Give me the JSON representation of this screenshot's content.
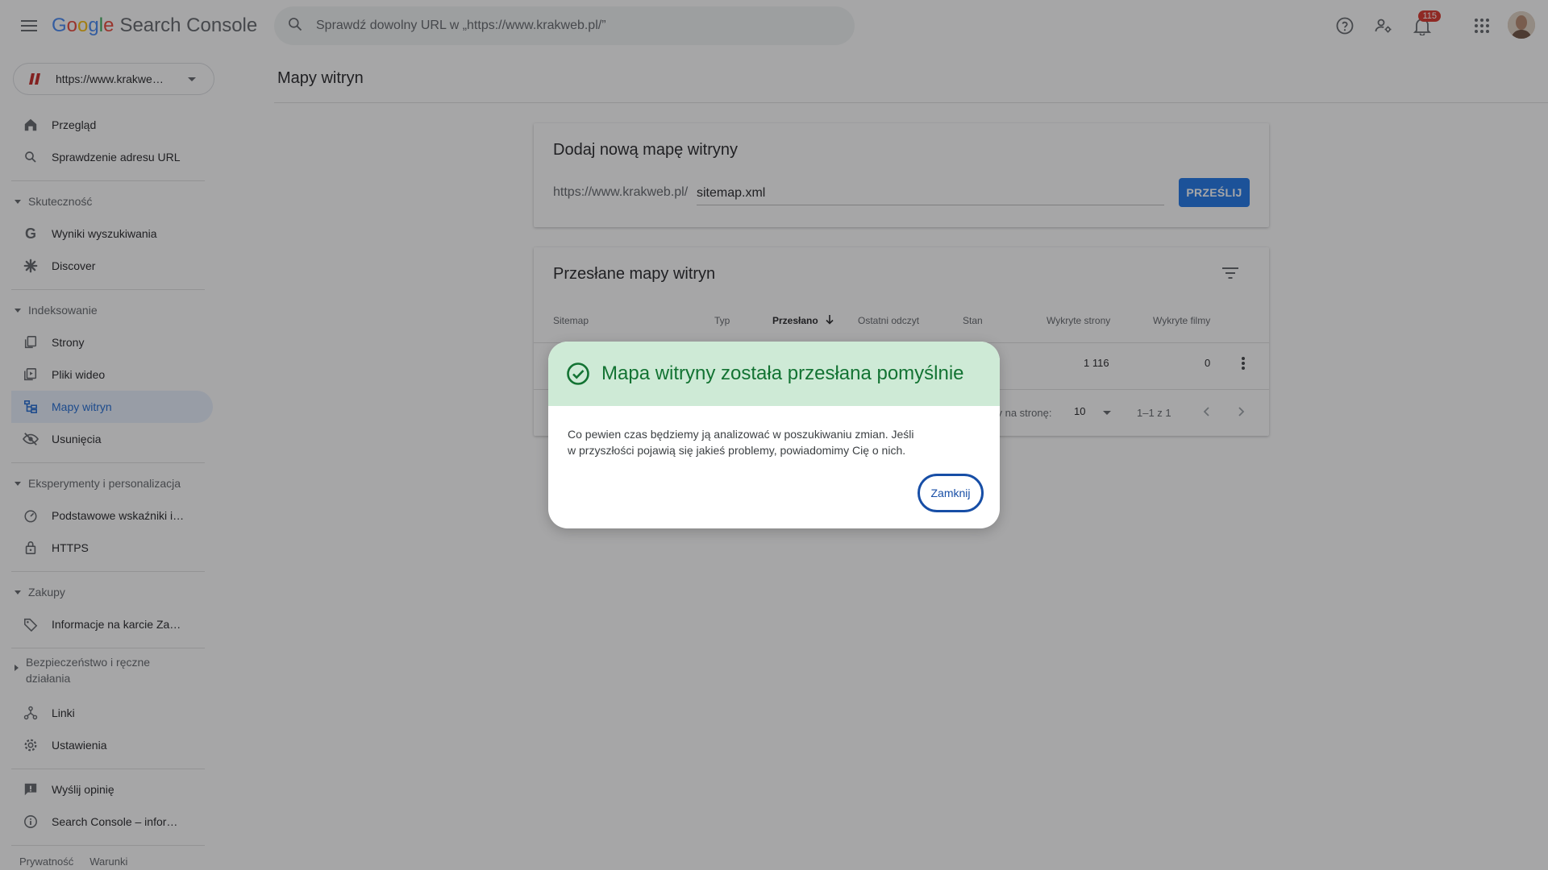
{
  "app": {
    "logo_letters": [
      "G",
      "o",
      "o",
      "g",
      "l",
      "e"
    ],
    "product_name": "Search Console"
  },
  "search": {
    "placeholder": "Sprawdź dowolny URL w „https://www.krakweb.pl/”"
  },
  "topbar": {
    "notifications_count": "115"
  },
  "property": {
    "label": "https://www.krakwe…"
  },
  "sidebar": {
    "items": [
      {
        "label": "Przegląd",
        "icon": "home-icon"
      },
      {
        "label": "Sprawdzenie adresu URL",
        "icon": "search-icon"
      }
    ],
    "sections": [
      {
        "label": "Skuteczność",
        "items": [
          {
            "label": "Wyniki wyszukiwania",
            "icon": "google-g-icon"
          },
          {
            "label": "Discover",
            "icon": "asterisk-icon"
          }
        ]
      },
      {
        "label": "Indeksowanie",
        "items": [
          {
            "label": "Strony",
            "icon": "pages-icon"
          },
          {
            "label": "Pliki wideo",
            "icon": "video-pages-icon"
          },
          {
            "label": "Mapy witryn",
            "icon": "sitemap-icon"
          },
          {
            "label": "Usunięcia",
            "icon": "eye-off-icon"
          }
        ]
      },
      {
        "label": "Eksperymenty i personalizacja",
        "items": [
          {
            "label": "Podstawowe wskaźniki i…",
            "icon": "speed-icon"
          },
          {
            "label": "HTTPS",
            "icon": "lock-icon"
          }
        ]
      },
      {
        "label": "Zakupy",
        "items": [
          {
            "label": "Informacje na karcie Za…",
            "icon": "tag-icon"
          }
        ]
      },
      {
        "label": "Bezpieczeństwo i ręczne działania",
        "items": []
      }
    ],
    "bottom_items": [
      {
        "label": "Linki",
        "icon": "links-icon"
      },
      {
        "label": "Ustawienia",
        "icon": "gear-icon"
      },
      {
        "label": "Wyślij opinię",
        "icon": "feedback-icon"
      },
      {
        "label": "Search Console – infor…",
        "icon": "info-icon"
      }
    ],
    "footer": {
      "privacy": "Prywatność",
      "terms": "Warunki"
    }
  },
  "main": {
    "page_title": "Mapy witryn",
    "add_card": {
      "title": "Dodaj nową mapę witryny",
      "prefix": "https://www.krakweb.pl/",
      "input_value": "sitemap.xml",
      "submit_label": "PRZEŚLIJ"
    },
    "submitted_card": {
      "title": "Przesłane mapy witryn",
      "columns": [
        "Sitemap",
        "Typ",
        "Przesłano",
        "Ostatni odczyt",
        "Stan",
        "Wykryte strony",
        "Wykryte filmy"
      ],
      "row": {
        "pages": "1 116",
        "videos": "0"
      },
      "pagination": {
        "rows_label": "zy na stronę:",
        "rows_value": "10",
        "count": "1–1 z 1"
      }
    }
  },
  "dialog": {
    "title": "Mapa witryny została przesłana pomyślnie",
    "body_line1": "Co pewien czas będziemy ją analizować w poszukiwaniu zmian. Jeśli",
    "body_line2": "w przyszłości pojawią się jakieś problemy, powiadomimy Cię o nich.",
    "close_label": "Zamknij"
  },
  "colors": {
    "accent": "#1a73e8",
    "success_bg": "#ceead6",
    "success_text": "#137333",
    "badge": "#d93025"
  }
}
